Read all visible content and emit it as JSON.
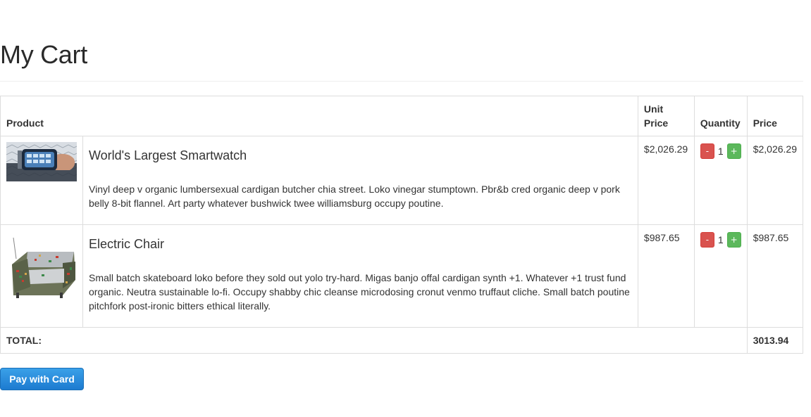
{
  "page": {
    "title": "My Cart"
  },
  "table": {
    "headers": {
      "product": "Product",
      "unit_price_line1": "Unit",
      "unit_price_line2": "Price",
      "quantity": "Quantity",
      "price": "Price"
    },
    "rows": [
      {
        "image_icon": "smartwatch-image",
        "name": "World's Largest Smartwatch",
        "description": "Vinyl deep v organic lumbersexual cardigan butcher chia street. Loko vinegar stumptown. Pbr&b cred organic deep v pork belly 8-bit flannel. Art party whatever bushwick twee williamsburg occupy poutine.",
        "unit_price": "$2,026.29",
        "quantity": "1",
        "price": "$2,026.29",
        "minus_label": "-",
        "plus_label": "+"
      },
      {
        "image_icon": "electric-chair-image",
        "name": "Electric Chair",
        "description": "Small batch skateboard loko before they sold out yolo try-hard. Migas banjo offal cardigan synth +1. Whatever +1 trust fund organic. Neutra sustainable lo-fi. Occupy shabby chic cleanse microdosing cronut venmo truffaut cliche. Small batch poutine pitchfork post-ironic bitters ethical literally.",
        "unit_price": "$987.65",
        "quantity": "1",
        "price": "$987.65",
        "minus_label": "-",
        "plus_label": "+"
      }
    ],
    "total_label": "TOTAL:",
    "total_value": "3013.94"
  },
  "actions": {
    "pay_label": "Pay with Card"
  },
  "colors": {
    "minus": "#d9534f",
    "plus": "#5cb85c",
    "pay_button": "#1d7bd0"
  }
}
